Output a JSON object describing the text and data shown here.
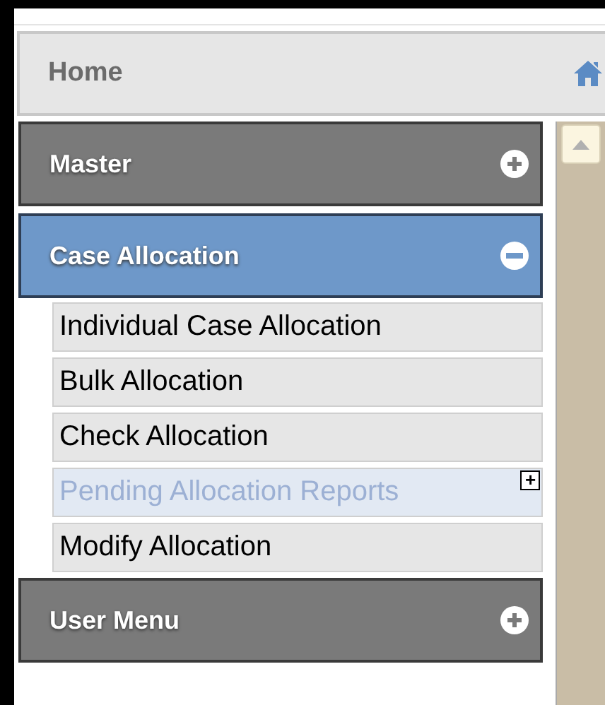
{
  "home": {
    "label": "Home"
  },
  "sections": [
    {
      "label": "Master",
      "expanded": false
    },
    {
      "label": "Case Allocation",
      "expanded": true,
      "items": [
        {
          "label": "Individual Case Allocation",
          "highlighted": false
        },
        {
          "label": "Bulk Allocation",
          "highlighted": false
        },
        {
          "label": "Check Allocation",
          "highlighted": false
        },
        {
          "label": "Pending Allocation Reports",
          "highlighted": true,
          "expander": "+"
        },
        {
          "label": "Modify Allocation",
          "highlighted": false
        }
      ]
    },
    {
      "label": "User Menu",
      "expanded": false
    }
  ]
}
